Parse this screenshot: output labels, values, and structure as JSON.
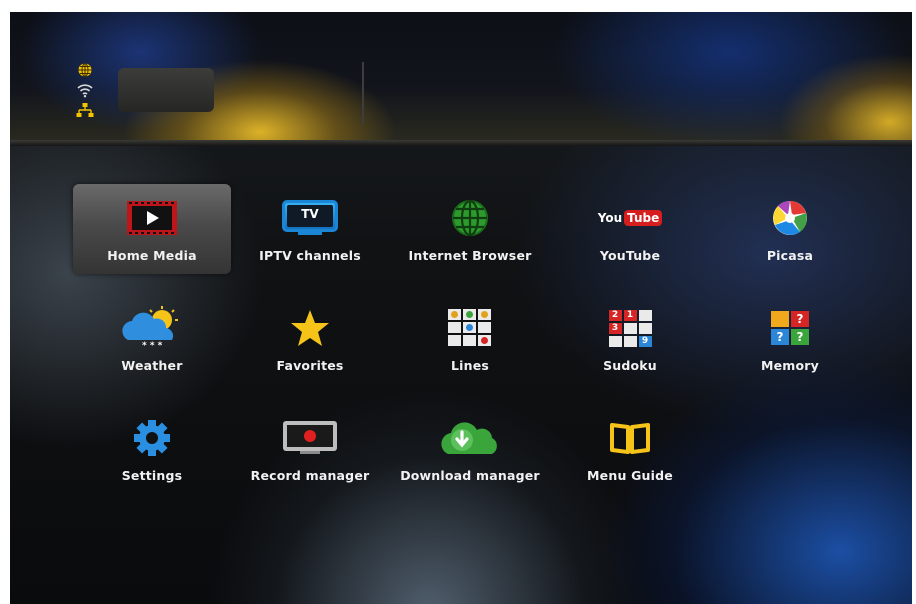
{
  "menu": {
    "items": [
      {
        "label": "Home Media",
        "icon": "home-media-icon"
      },
      {
        "label": "IPTV channels",
        "icon": "tv-icon",
        "icon_text": "TV"
      },
      {
        "label": "Internet Browser",
        "icon": "globe-icon"
      },
      {
        "label": "YouTube",
        "icon": "youtube-icon",
        "icon_text_left": "You",
        "icon_text_right": "Tube"
      },
      {
        "label": "Picasa",
        "icon": "picasa-icon"
      },
      {
        "label": "Weather",
        "icon": "weather-icon"
      },
      {
        "label": "Favorites",
        "icon": "star-icon"
      },
      {
        "label": "Lines",
        "icon": "lines-game-icon"
      },
      {
        "label": "Sudoku",
        "icon": "sudoku-icon",
        "icon_digits": [
          "2",
          "1",
          "3",
          "9"
        ]
      },
      {
        "label": "Memory",
        "icon": "memory-game-icon",
        "icon_text": "?"
      },
      {
        "label": "Settings",
        "icon": "gear-icon"
      },
      {
        "label": "Record manager",
        "icon": "record-icon"
      },
      {
        "label": "Download manager",
        "icon": "download-cloud-icon"
      },
      {
        "label": "Menu Guide",
        "icon": "book-icon"
      }
    ],
    "selected": "Home Media"
  },
  "status": {
    "icons": [
      "globe-status-icon",
      "wifi-icon",
      "network-icon"
    ]
  },
  "colors": {
    "accent_yellow": "#f2c500",
    "selection_bg": "#555555",
    "label_text": "#f2f2f2",
    "youtube_red": "#d61e1e",
    "tv_blue": "#1f8fd8",
    "settings_blue": "#2a8fe0"
  }
}
